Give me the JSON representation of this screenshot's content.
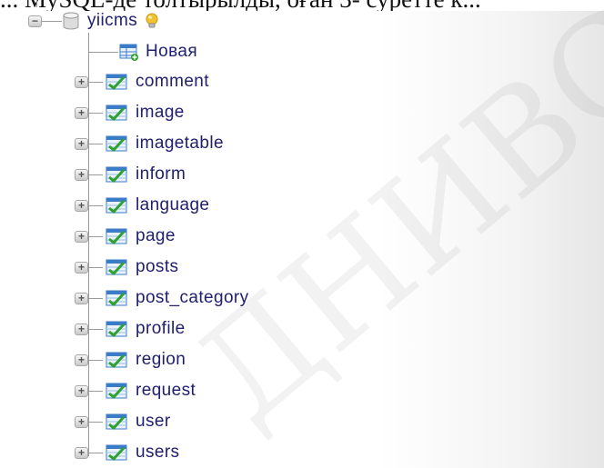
{
  "document_text": "... MySQL-де толтырылды, оған 3- суретте к...",
  "watermark": "ДНИВС",
  "tree": {
    "root": {
      "label": "yiicms",
      "icon": "database-icon",
      "badge_icon": "lightbulb-icon"
    },
    "new_item": {
      "label": "Новая",
      "icon": "new-table-icon"
    },
    "tables": [
      {
        "label": "comment"
      },
      {
        "label": "image"
      },
      {
        "label": "imagetable"
      },
      {
        "label": "inform"
      },
      {
        "label": "language"
      },
      {
        "label": "page"
      },
      {
        "label": "posts"
      },
      {
        "label": "post_category"
      },
      {
        "label": "profile"
      },
      {
        "label": "region"
      },
      {
        "label": "request"
      },
      {
        "label": "user"
      },
      {
        "label": "users"
      }
    ],
    "expander_symbol_collapsed": "+",
    "expander_symbol_expanded": "−"
  },
  "colors": {
    "label": "#20206e",
    "connector": "#9a9a9a",
    "table_icon_blue": "#3a7cc8",
    "table_icon_green": "#2ea12e",
    "bulb": "#f2c230"
  }
}
